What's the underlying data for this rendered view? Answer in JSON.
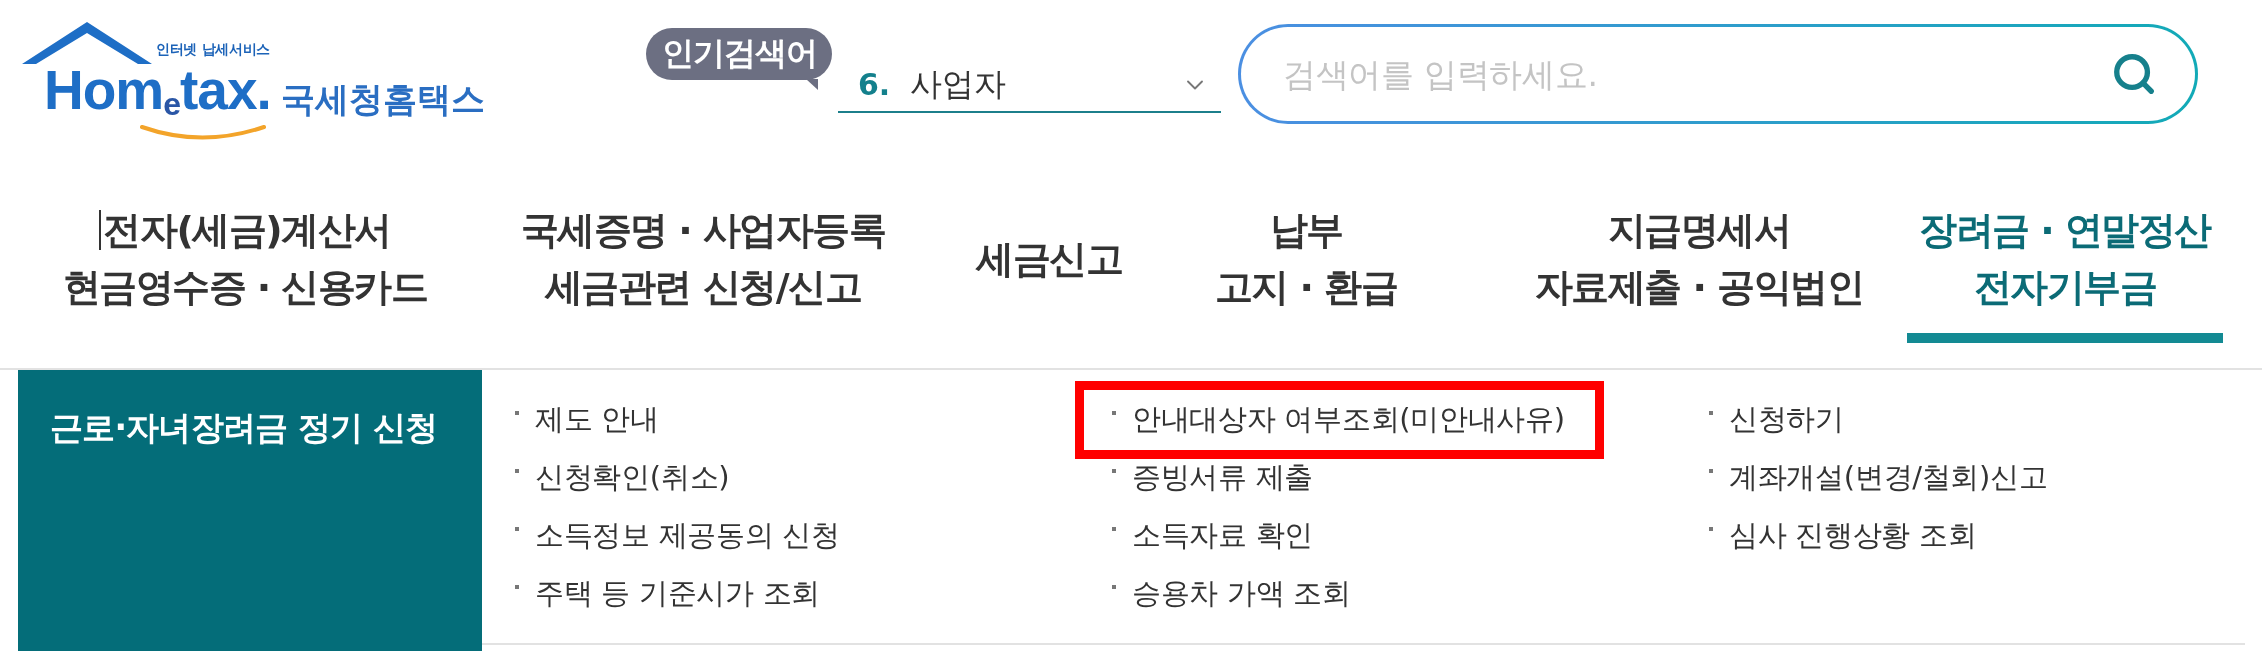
{
  "header": {
    "logo": {
      "tagline": "인터넷 납세서비스",
      "wordmark": "Hom$_{e}$tax.",
      "name": "국세청홈택스"
    },
    "popular_search": {
      "badge": "인기검색어",
      "rank": "6.",
      "keyword": "사업자"
    },
    "search": {
      "placeholder": "검색어를 입력하세요."
    }
  },
  "nav": {
    "items": [
      {
        "lines": [
          "전자(세금)계산서",
          "현금영수증 · 신용카드"
        ],
        "selected": false,
        "caret": true
      },
      {
        "lines": [
          "국세증명 · 사업자등록",
          "세금관련 신청/신고"
        ],
        "selected": false,
        "caret": false
      },
      {
        "lines": [
          "세금신고"
        ],
        "selected": false,
        "caret": false
      },
      {
        "lines": [
          "납부",
          "고지 · 환급"
        ],
        "selected": false,
        "caret": false
      },
      {
        "lines": [
          "지급명세서",
          "자료제출 · 공익법인"
        ],
        "selected": false,
        "caret": false
      },
      {
        "lines": [
          "장려금 · 연말정산",
          "전자기부금"
        ],
        "selected": true,
        "caret": false
      }
    ]
  },
  "submenu": {
    "title": "근로·자녀장려금 정기 신청",
    "columns": [
      {
        "items": [
          {
            "label": "제도 안내",
            "highlighted": false
          },
          {
            "label": "신청확인(취소)",
            "highlighted": false
          },
          {
            "label": "소득정보 제공동의 신청",
            "highlighted": false
          },
          {
            "label": "주택 등 기준시가 조회",
            "highlighted": false
          }
        ]
      },
      {
        "items": [
          {
            "label": "안내대상자 여부조회(미안내사유)",
            "highlighted": true
          },
          {
            "label": "증빙서류 제출",
            "highlighted": false
          },
          {
            "label": "소득자료 확인",
            "highlighted": false
          },
          {
            "label": "승용차 가액 조회",
            "highlighted": false
          }
        ]
      },
      {
        "items": [
          {
            "label": "신청하기",
            "highlighted": false
          },
          {
            "label": "계좌개설(변경/철회)신고",
            "highlighted": false
          },
          {
            "label": "심사 진행상황 조회",
            "highlighted": false
          }
        ]
      }
    ]
  }
}
